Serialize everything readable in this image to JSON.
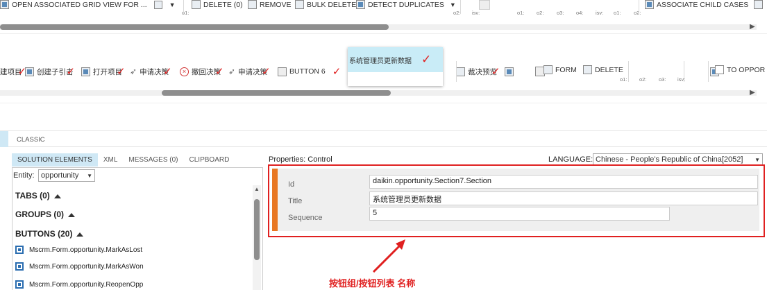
{
  "ribbon1": {
    "items": [
      {
        "label": "OPEN ASSOCIATED GRID VIEW FOR ..."
      },
      {
        "label": "DELETE (0)"
      },
      {
        "label": "REMOVE"
      },
      {
        "label": "BULK DELETE"
      },
      {
        "label": "DETECT DUPLICATES"
      },
      {
        "label": "ASSOCIATE CHILD CASES"
      }
    ],
    "sublabels": [
      "o1:",
      "o2:",
      "isv:",
      "o1:",
      "o2:",
      "o3:",
      "o4:",
      "isv:",
      "o1:",
      "o2:"
    ]
  },
  "ribbon2": {
    "items": [
      {
        "label": "建项目"
      },
      {
        "label": "创建子引击"
      },
      {
        "label": "打开项目"
      },
      {
        "label": "申请决策"
      },
      {
        "label": "撤回决策"
      },
      {
        "label": "申请决策"
      },
      {
        "label": "BUTTON 6"
      },
      {
        "label": "裁决预览"
      },
      {
        "label": "FORM"
      },
      {
        "label": "DELETE"
      },
      {
        "label": "TO OPPOR"
      }
    ],
    "sublabels": [
      "o1:",
      "o2:",
      "o3:",
      "isv:"
    ],
    "popup": {
      "label": "系统管理员更新数据"
    }
  },
  "tabbar": {
    "label": "CLASSIC"
  },
  "left": {
    "tabs": [
      "SOLUTION ELEMENTS",
      "XML",
      "MESSAGES (0)",
      "CLIPBOARD"
    ],
    "entity_label": "Entity:",
    "entity_value": "opportunity",
    "sections": [
      {
        "label": "TABS (0)"
      },
      {
        "label": "GROUPS (0)"
      },
      {
        "label": "BUTTONS (20)"
      }
    ],
    "buttons": [
      "Mscrm.Form.opportunity.MarkAsLost",
      "Mscrm.Form.opportunity.MarkAsWon",
      "Mscrm.Form.opportunity.ReopenOpp"
    ]
  },
  "right": {
    "header": "Properties: Control",
    "language_label": "LANGUAGE:",
    "language_value": "Chinese - People's Republic of China[2052]",
    "props": [
      {
        "label": "Id",
        "value": "daikin.opportunity.Section7.Section"
      },
      {
        "label": "Title",
        "value": "系统管理员更新数据"
      },
      {
        "label": "Sequence",
        "value": "5"
      }
    ],
    "annotation": "按钮组/按钮列表 名称"
  },
  "colors": {
    "accent": "#e02020",
    "tab_active": "#cfe8f5",
    "orange": "#e87722"
  }
}
